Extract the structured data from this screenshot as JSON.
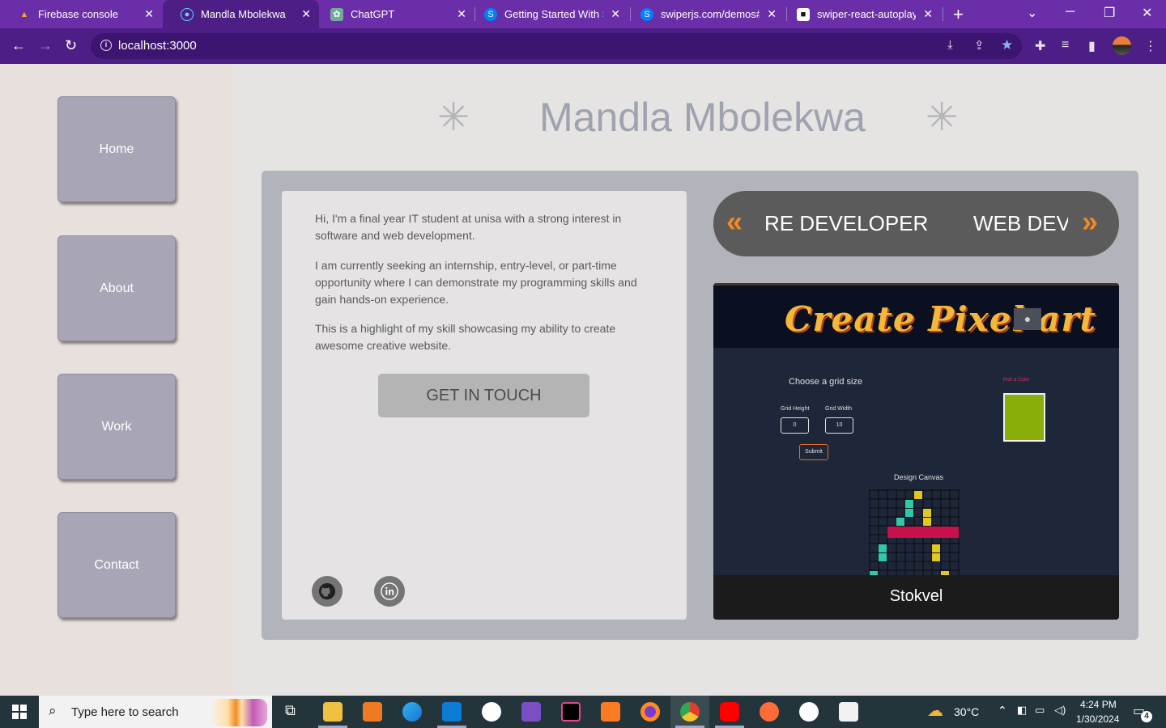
{
  "browser": {
    "tabs": [
      {
        "title": "Firebase console",
        "icon": "flame-icon",
        "color": "#f6a623"
      },
      {
        "title": "Mandla Mbolekwa",
        "icon": "react-icon",
        "color": "#61dafb"
      },
      {
        "title": "ChatGPT",
        "icon": "chatgpt-icon",
        "color": "#74aa9c"
      },
      {
        "title": "Getting Started With S",
        "icon": "swiper-icon",
        "color": "#0080ff"
      },
      {
        "title": "swiperjs.com/demos#a",
        "icon": "swiper-icon",
        "color": "#0080ff"
      },
      {
        "title": "swiper-react-autoplay",
        "icon": "codesandbox-icon",
        "color": "#151515"
      }
    ],
    "url": "localhost:3000"
  },
  "site": {
    "title": "Mandla Mbolekwa",
    "nav": [
      "Home",
      "About",
      "Work",
      "Contact"
    ],
    "intro": [
      "Hi, I'm a final year IT student at unisa with a strong interest in software and web development.",
      "I am currently seeking an internship, entry-level, or part-time opportunity where I can demonstrate my programming skills and gain hands-on experience.",
      "This is a highlight of my skill showcasing my ability to create awesome creative website."
    ],
    "cta": "GET IN TOUCH",
    "slider": {
      "current": "RE DEVELOPER",
      "next": "WEB DEVELOPER"
    },
    "project": {
      "name": "Stokvel",
      "preview": {
        "title": "Create Pixel art",
        "grid_label": "Choose a grid size",
        "height_label": "Grid Height",
        "height_value": "0",
        "width_label": "Grid Width",
        "width_value": "10",
        "submit": "Submit",
        "color_label": "Pick a Color",
        "canvas_label": "Design Canvas",
        "swatch_color": "#89ae0a"
      }
    }
  },
  "taskbar": {
    "search_placeholder": "Type here to search",
    "weather": "30°C",
    "time": "4:24 PM",
    "date": "1/30/2024",
    "notifications": "4"
  }
}
